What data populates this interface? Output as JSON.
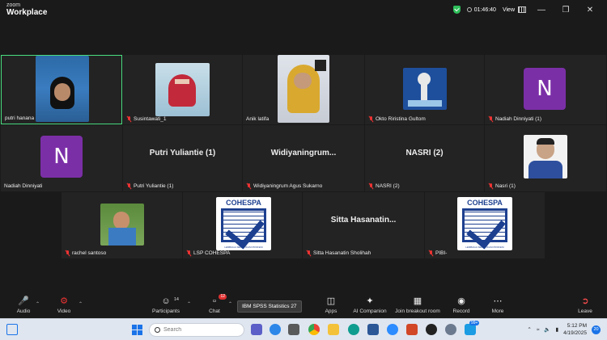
{
  "titlebar": {
    "logo_top": "zoom",
    "logo_bottom": "Workplace",
    "timer": "01:46:40",
    "view_label": "View"
  },
  "participants": [
    {
      "name": "putri hanana",
      "muted": false,
      "type": "video"
    },
    {
      "name": "Susintawati_1",
      "muted": true,
      "type": "photo"
    },
    {
      "name": "Anik latifa",
      "muted": false,
      "type": "photo"
    },
    {
      "name": "Okto Riristina Gultom",
      "muted": true,
      "type": "photo"
    },
    {
      "name": "Nadiah Dinniyati (1)",
      "muted": true,
      "type": "avatar",
      "initial": "N"
    },
    {
      "name": "Nadiah Dinniyati",
      "muted": false,
      "type": "avatar",
      "initial": "N"
    },
    {
      "name": "Putri Yuliantie (1)",
      "muted": true,
      "type": "text",
      "display": "Putri Yuliantie (1)"
    },
    {
      "name": "Widiyaningrum Agus Sukarno",
      "muted": true,
      "type": "text",
      "display": "Widiyaningrum..."
    },
    {
      "name": "NASRI (2)",
      "muted": true,
      "type": "text",
      "display": "NASRI (2)"
    },
    {
      "name": "Nasri (1)",
      "muted": true,
      "type": "photo"
    },
    {
      "name": "rachel santoso",
      "muted": true,
      "type": "photo"
    },
    {
      "name": "LSP COHESPA",
      "muted": true,
      "type": "logo"
    },
    {
      "name": "Sitta Hasanatin Sholihah",
      "muted": true,
      "type": "text",
      "display": "Sitta Hasanatin..."
    },
    {
      "name": "PIBI-",
      "muted": true,
      "type": "logo"
    }
  ],
  "cohespa": {
    "title": "COHESPA",
    "subtitle": "LEMBAGA SERTIFIKASI PROFESI"
  },
  "toolbar": {
    "audio": "Audio",
    "video": "Video",
    "participants": "Participants",
    "participants_count": "14",
    "chat": "Chat",
    "chat_badge": "12",
    "apps": "Apps",
    "ai_companion": "AI Companion",
    "breakout": "Join breakout room",
    "record": "Record",
    "more": "More",
    "leave": "Leave"
  },
  "tooltip": "IBM SPSS Statistics 27",
  "taskbar": {
    "search_placeholder": "Search",
    "time": "5:12 PM",
    "date": "4/19/2025",
    "notifications": "20",
    "badge_99": "99+"
  },
  "colors": {
    "active_border": "#4ade80",
    "avatar_purple": "#7b2fa7",
    "muted_red": "#e33333",
    "leave_red": "#ff4d4d",
    "cohespa_blue": "#1c3f8f"
  }
}
